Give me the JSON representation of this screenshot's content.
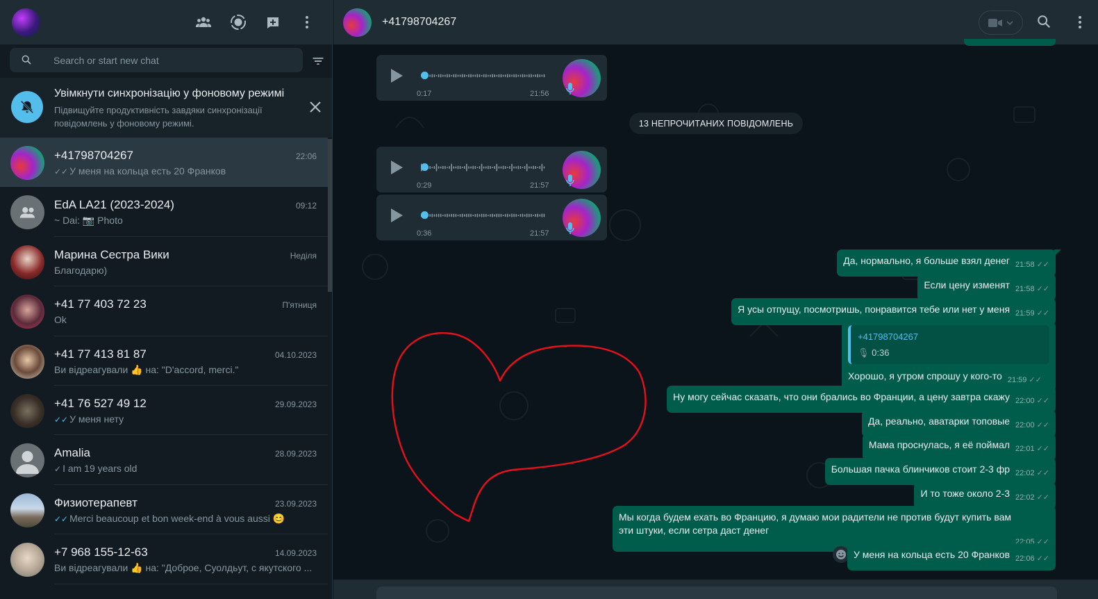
{
  "left": {
    "search_placeholder": "Search or start new chat",
    "banner": {
      "title": "Увімкнути синхронізацію у фоновому режимі",
      "desc": "Підвищуйте продуктивність завдяки синхронізації повідомлень у фоновому режимі."
    },
    "chats": [
      {
        "name": "+41798704267",
        "time": "22:06",
        "tick": "✓✓",
        "preview": "У меня на кольца есть 20 Франков"
      },
      {
        "name": "EdA LA21 (2023-2024)",
        "time": "09:12",
        "tick": "",
        "preview": "~ Dai: 📷 Photo"
      },
      {
        "name": "Марина Сестра Вики",
        "time": "Неділя",
        "tick": "",
        "preview": "Благодарю)"
      },
      {
        "name": "+41 77 403 72 23",
        "time": "П'ятниця",
        "tick": "",
        "preview": "Ok"
      },
      {
        "name": "+41 77 413 81 87",
        "time": "04.10.2023",
        "tick": "",
        "preview": "Ви відреагували 👍 на: \"D'accord, merci.\""
      },
      {
        "name": "+41 76 527 49 12",
        "time": "29.09.2023",
        "tick": "✓✓",
        "preview": "У меня нету"
      },
      {
        "name": "Amalia",
        "time": "28.09.2023",
        "tick": "✓",
        "preview": "I am 19 years old"
      },
      {
        "name": "Физиотерапевт",
        "time": "23.09.2023",
        "tick": "✓✓",
        "preview": "Merci beaucoup et bon week-end à vous aussi 😊"
      },
      {
        "name": "+7 968 155-12-63",
        "time": "14.09.2023",
        "tick": "",
        "preview": "Ви відреагували 👍 на: \"Доброе,  Суолдьут, с якутского ..."
      }
    ]
  },
  "conversation": {
    "title": "+41798704267",
    "voice_notes": [
      {
        "duration": "0:17",
        "time": "21:56"
      },
      {
        "duration": "0:29",
        "time": "21:57"
      },
      {
        "duration": "0:36",
        "time": "21:57"
      }
    ],
    "unread_label": "13 НЕПРОЧИТАНИХ ПОВІДОМЛЕНЬ",
    "messages": [
      {
        "text": "Да, нормально, я больше взял денег",
        "time": "21:58"
      },
      {
        "text": "Если цену изменят",
        "time": "21:58"
      },
      {
        "text": "Я усы отпущу, посмотришь, понравится тебе или нет у меня",
        "time": "21:59"
      },
      {
        "text": "Хорошо, я утром спрошу у кого-то",
        "time": "21:59",
        "quote_name": "+41798704267",
        "quote_body": "0:36"
      },
      {
        "text": "Ну могу сейчас сказать, что они брались во Франции, а цену завтра скажу",
        "time": "22:00"
      },
      {
        "text": "Да, реально, аватарки топовые",
        "time": "22:00"
      },
      {
        "text": "Мама проснулась, я её поймал",
        "time": "22:01"
      },
      {
        "text": "Большая пачка блинчиков стоит 2-3 фр",
        "time": "22:02"
      },
      {
        "text": "И то тоже около 2-3",
        "time": "22:02"
      },
      {
        "text": "Мы когда будем ехать во Францию, я думаю мои радители не против будут купить вам эти штуки, если сетра даст денег",
        "time": "22:05"
      },
      {
        "text": "У меня на кольца есть 20 Франков",
        "time": "22:06"
      }
    ]
  }
}
